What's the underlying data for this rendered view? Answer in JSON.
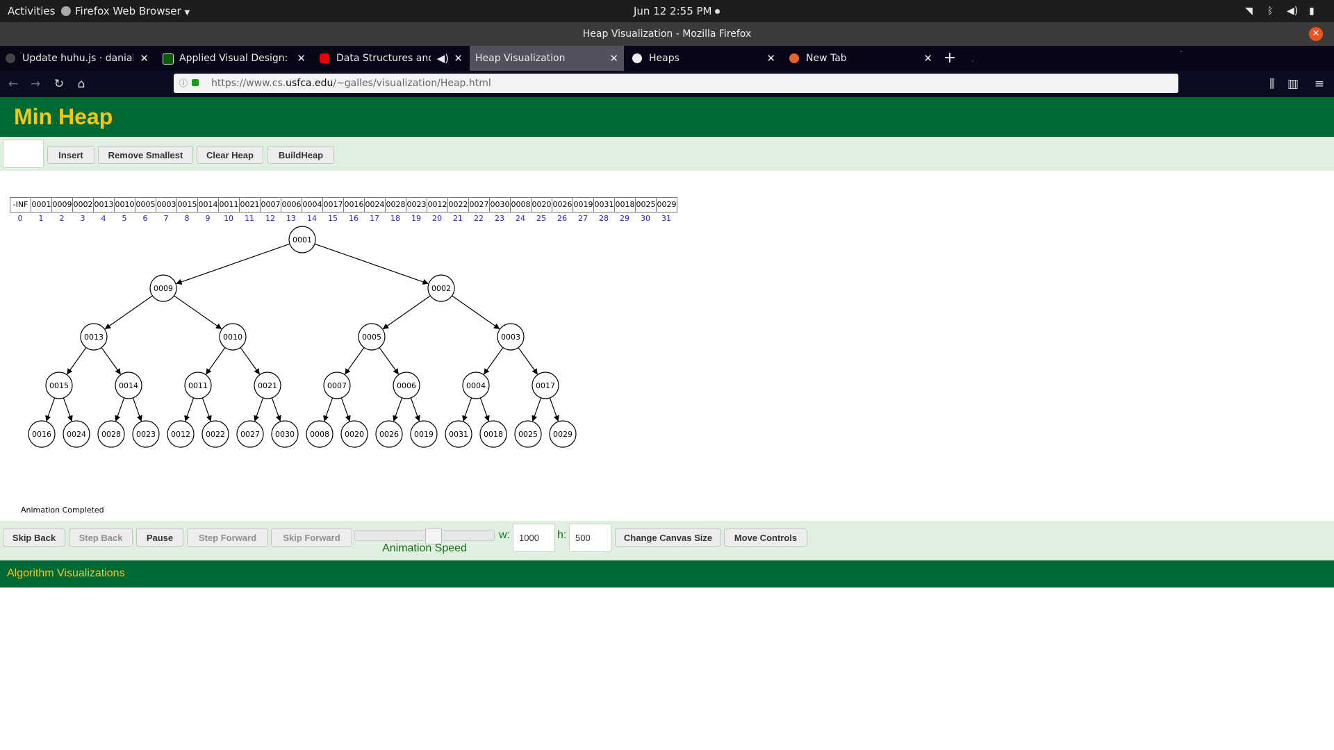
{
  "system": {
    "activities": "Activities",
    "app_name": "Firefox Web Browser",
    "clock": "Jun 12  2:55 PM"
  },
  "window": {
    "title": "Heap Visualization - Mozilla Firefox"
  },
  "tabs": [
    {
      "label": "Update huhu.js · danialnx/",
      "favicon": "github-icon"
    },
    {
      "label": "Applied Visual Design: Adj",
      "favicon": "freecodecamp-icon"
    },
    {
      "label": "Data Structures and Alg",
      "favicon": "youtube-icon"
    },
    {
      "label": "Heap Visualization",
      "favicon": "none"
    },
    {
      "label": "Heaps",
      "favicon": "site-icon"
    },
    {
      "label": "New Tab",
      "favicon": "firefox-icon"
    }
  ],
  "url": {
    "prefix": "https://www.cs.",
    "domain": "usfca.edu",
    "path": "/~galles/visualization/Heap.html"
  },
  "page": {
    "title": "Min Heap",
    "controls": {
      "insert_value": "",
      "insert": "Insert",
      "remove_smallest": "Remove Smallest",
      "clear_heap": "Clear Heap",
      "build_heap": "BuildHeap"
    },
    "status": "Animation Completed",
    "anim": {
      "skip_back": "Skip Back",
      "step_back": "Step Back",
      "pause": "Pause",
      "step_forward": "Step Forward",
      "skip_forward": "Skip Forward",
      "speed_label": "Animation Speed",
      "speed_fraction": 0.57,
      "w_label": "w:",
      "w_value": "1000",
      "h_label": "h:",
      "h_value": "500",
      "change_canvas": "Change Canvas Size",
      "move_controls": "Move Controls"
    },
    "footer": "Algorithm Visualizations"
  },
  "heap": {
    "array": [
      "-INF",
      "0001",
      "0009",
      "0002",
      "0013",
      "0010",
      "0005",
      "0003",
      "0015",
      "0014",
      "0011",
      "0021",
      "0007",
      "0006",
      "0004",
      "0017",
      "0016",
      "0024",
      "0028",
      "0023",
      "0012",
      "0022",
      "0027",
      "0030",
      "0008",
      "0020",
      "0026",
      "0019",
      "0031",
      "0018",
      "0025",
      "0029"
    ],
    "indices": [
      "0",
      "1",
      "2",
      "3",
      "4",
      "5",
      "6",
      "7",
      "8",
      "9",
      "10",
      "11",
      "12",
      "13",
      "14",
      "15",
      "16",
      "17",
      "18",
      "19",
      "20",
      "21",
      "22",
      "23",
      "24",
      "25",
      "26",
      "27",
      "28",
      "29",
      "30",
      "31"
    ]
  }
}
